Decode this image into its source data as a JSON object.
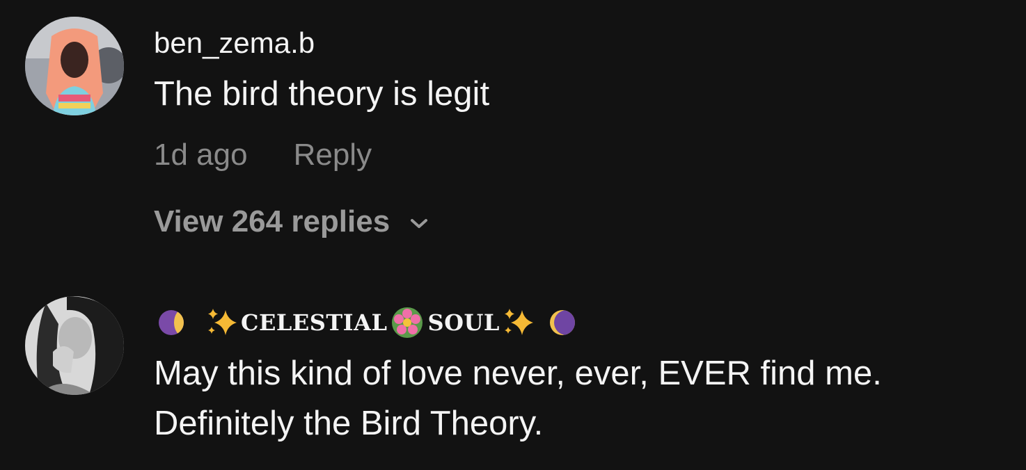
{
  "comments": [
    {
      "username": "ben_zema.b",
      "text": "The bird theory is legit",
      "time": "1d ago",
      "reply_label": "Reply",
      "view_replies": "View 264 replies",
      "avatar": "avatar-photo"
    },
    {
      "username_icons": [
        "moon-icon",
        "sparkles-icon",
        "flower-icon",
        "sparkles-icon",
        "moon-icon"
      ],
      "username_word1": "CELESTIAL",
      "username_word2": "SOUL",
      "text_line1": "May this kind of love never, ever, EVER find me.",
      "text_line2": "Definitely the Bird Theory.",
      "avatar": "avatar-photo"
    }
  ],
  "colors": {
    "background": "#121212",
    "text": "#f4f4f4",
    "muted": "#8a8a8a"
  }
}
